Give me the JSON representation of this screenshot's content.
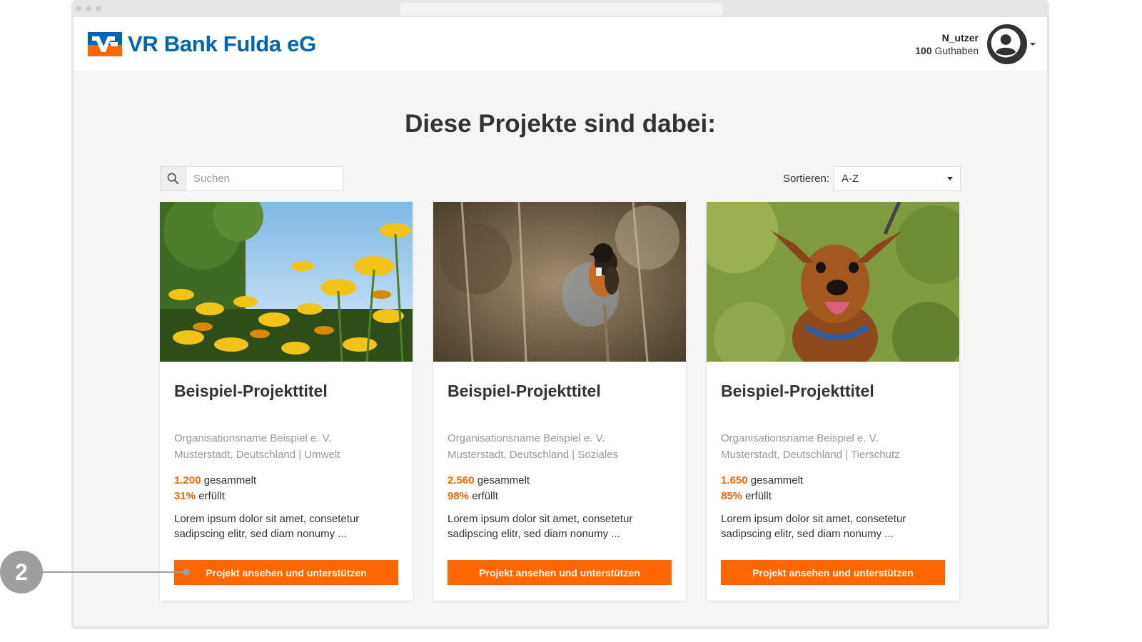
{
  "header": {
    "logo_text": "VR Bank Fulda eG",
    "user_name": "N_utzer",
    "credit_amount": "100",
    "credit_label": "Guthaben"
  },
  "main": {
    "heading": "Diese Projekte sind dabei:",
    "search_placeholder": "Suchen",
    "sort_label": "Sortieren:",
    "sort_value": "A-Z"
  },
  "cards": [
    {
      "title": "Beispiel-Projekttitel",
      "org": "Organisationsname Beispiel e. V.",
      "location": "Musterstadt, Deutschland | Umwelt",
      "collected": "1.200",
      "collected_label": "gesammelt",
      "percent": "31%",
      "percent_label": "erfüllt",
      "description": "Lorem ipsum dolor sit amet, consetetur sadipscing elitr, sed diam nonumy ...",
      "button": "Projekt ansehen und unterstützen",
      "image": "yellow-flowers-image"
    },
    {
      "title": "Beispiel-Projekttitel",
      "org": "Organisationsname Beispiel e. V.",
      "location": "Musterstadt, Deutschland | Soziales",
      "collected": "2.560",
      "collected_label": "gesammelt",
      "percent": "98%",
      "percent_label": "erfüllt",
      "description": "Lorem ipsum dolor sit amet, consetetur sadipscing elitr, sed diam nonumy ...",
      "button": "Projekt ansehen und unterstützen",
      "image": "bird-on-branch-image"
    },
    {
      "title": "Beispiel-Projekttitel",
      "org": "Organisationsname Beispiel e. V.",
      "location": "Musterstadt, Deutschland | Tierschutz",
      "collected": "1.650",
      "collected_label": "gesammelt",
      "percent": "85%",
      "percent_label": "erfüllt",
      "description": "Lorem ipsum dolor sit amet, consetetur sadipscing elitr, sed diam nonumy ...",
      "button": "Projekt ansehen und unterstützen",
      "image": "dog-image"
    }
  ],
  "annotation": {
    "callout_number": "2"
  },
  "colors": {
    "brand_blue": "#0066b3",
    "accent_orange": "#ff6600"
  }
}
